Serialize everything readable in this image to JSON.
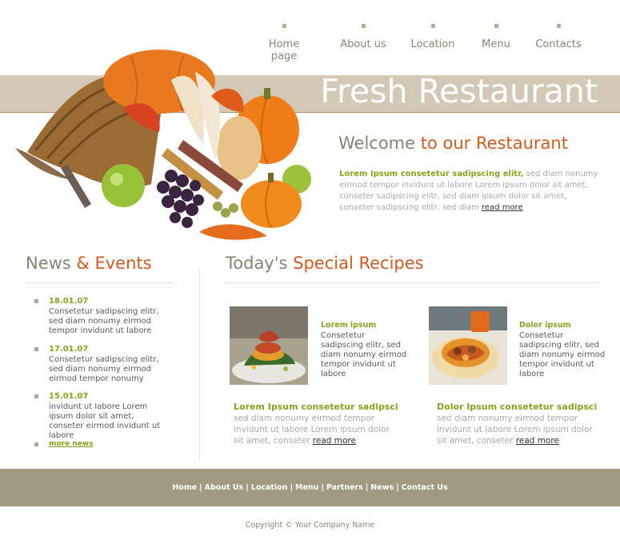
{
  "nav": [
    {
      "label": "Home page"
    },
    {
      "label": "About us"
    },
    {
      "label": "Location"
    },
    {
      "label": "Menu"
    },
    {
      "label": "Contacts"
    }
  ],
  "brand": "Fresh Restaurant",
  "welcome": {
    "part1": "Welcome ",
    "part2": "to our Restaurant"
  },
  "intro": {
    "lead": "Lorem Ipsum consetetur sadipscing elitr,",
    "text": " sed diam nonumy eirmod tempor invidunt ut labore Lorem ipsum dolor sit amet, conseter sadipscing elitr, sed diam ipsum dolor sit amet, conseter sadipscing elitr, sed diam ",
    "more": "read more"
  },
  "news": {
    "title1": "News ",
    "title2": "& Events",
    "items": [
      {
        "date": "18.01.07",
        "text": "Consetetur sadipscing elitr, sed diam nonumy eirmod tempor invidunt ut labore"
      },
      {
        "date": "17.01.07",
        "text": "Consetetur sadipscing elitr, sed diam nonumy eirmod eirmod tempor nonumy"
      },
      {
        "date": "15.01.07",
        "text": "invidunt ut labore Lorem ipsum dolor sit amet, conseter eirmod invidunt ut labore"
      }
    ],
    "more": "more news"
  },
  "recipes": {
    "title1": "Today's ",
    "title2": "Special Recipes",
    "items": [
      {
        "title": "Lorem ipsum",
        "text": "Consetetur sadipscing elitr, sed diam nonumy eirmod tempor invidunt ut labore",
        "head": "Lorem Ipsum consetetur sadipsci",
        "body": "sed diam nonumy eirmod tempor invidunt ut labore Lorem ipsum dolor sit amet, conseter ",
        "more": "read more"
      },
      {
        "title": "Dolor ipsum",
        "text": "Consetetur sadipscing elitr, sed diam nonumy eirmod tempor invidunt ut labore",
        "head": "Dolor Ipsum consetetur sadipsci",
        "body": "sed diam nonumy eirmod tempor invidunt ut labore Lorem ipsum dolor sit amet, conseter ",
        "more": "read more"
      }
    ]
  },
  "footer": {
    "links": [
      "Home",
      "About Us",
      "Location",
      "Menu",
      "Partners",
      "News",
      "Contact Us"
    ],
    "copyright": "Copyright © Your Company Name"
  },
  "colors": {
    "accent": "#d25a1e",
    "green": "#8aa11f",
    "banner": "#d3c8b5",
    "footer": "#a29a80"
  }
}
